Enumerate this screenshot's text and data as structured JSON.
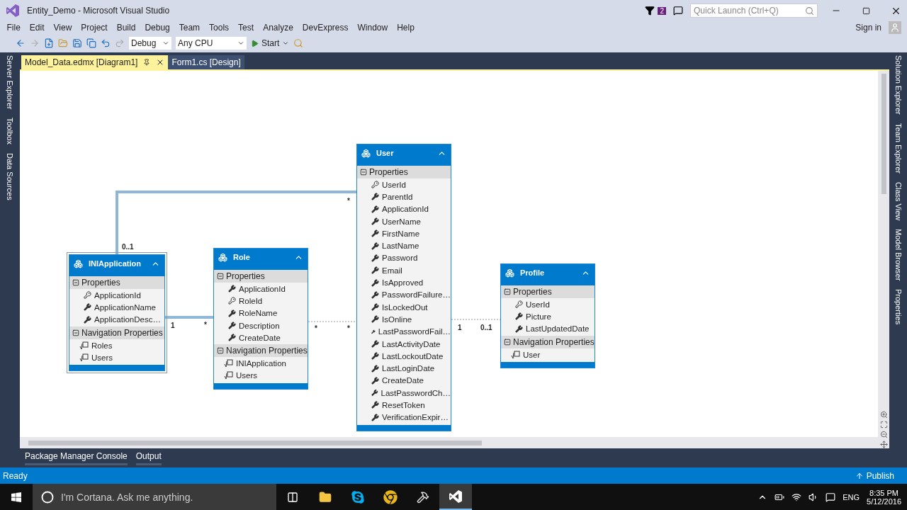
{
  "window": {
    "title": "Entity_Demo - Microsoft Visual Studio"
  },
  "notifications": {
    "count": "2"
  },
  "quick_launch": {
    "placeholder": "Quick Launch (Ctrl+Q)"
  },
  "menu": [
    "File",
    "Edit",
    "View",
    "Project",
    "Build",
    "Debug",
    "Team",
    "Tools",
    "Test",
    "Analyze",
    "DevExpress",
    "Window",
    "Help"
  ],
  "account": {
    "label": "Sign in"
  },
  "toolbar": {
    "configuration": "Debug",
    "platform": "Any CPU",
    "start": "Start"
  },
  "left_tabs": [
    "Server Explorer",
    "Toolbox",
    "Data Sources"
  ],
  "right_tabs": [
    "Solution Explorer",
    "Team Explorer",
    "Class View",
    "Model Browser",
    "Properties"
  ],
  "doc_tabs": [
    {
      "label": "Model_Data.edmx [Diagram1]",
      "selected": true
    },
    {
      "label": "Form1.cs [Design]",
      "selected": false
    }
  ],
  "entities": [
    {
      "name": "INIApplication",
      "selected": true,
      "sections": [
        {
          "label": "Properties",
          "items": [
            {
              "name": "ApplicationId",
              "kind": "key"
            },
            {
              "name": "ApplicationName",
              "kind": "scalar"
            },
            {
              "name": "ApplicationDesc…",
              "kind": "scalar"
            }
          ]
        },
        {
          "label": "Navigation Properties",
          "items": [
            {
              "name": "Roles",
              "kind": "navigation"
            },
            {
              "name": "Users",
              "kind": "navigation"
            }
          ]
        }
      ]
    },
    {
      "name": "Role",
      "selected": false,
      "sections": [
        {
          "label": "Properties",
          "items": [
            {
              "name": "ApplicationId",
              "kind": "scalar"
            },
            {
              "name": "RoleId",
              "kind": "key"
            },
            {
              "name": "RoleName",
              "kind": "scalar"
            },
            {
              "name": "Description",
              "kind": "scalar"
            },
            {
              "name": "CreateDate",
              "kind": "scalar"
            }
          ]
        },
        {
          "label": "Navigation Properties",
          "items": [
            {
              "name": "INIApplication",
              "kind": "navigation"
            },
            {
              "name": "Users",
              "kind": "navigation"
            }
          ]
        }
      ]
    },
    {
      "name": "User",
      "selected": false,
      "sections": [
        {
          "label": "Properties",
          "items": [
            {
              "name": "UserId",
              "kind": "key"
            },
            {
              "name": "ParentId",
              "kind": "scalar"
            },
            {
              "name": "ApplicationId",
              "kind": "scalar"
            },
            {
              "name": "UserName",
              "kind": "scalar"
            },
            {
              "name": "FirstName",
              "kind": "scalar"
            },
            {
              "name": "LastName",
              "kind": "scalar"
            },
            {
              "name": "Password",
              "kind": "scalar"
            },
            {
              "name": "Email",
              "kind": "scalar"
            },
            {
              "name": "IsApproved",
              "kind": "scalar"
            },
            {
              "name": "PasswordFailure…",
              "kind": "scalar"
            },
            {
              "name": "IsLockedOut",
              "kind": "scalar"
            },
            {
              "name": "IsOnline",
              "kind": "scalar"
            },
            {
              "name": "LastPasswordFail…",
              "kind": "scalar"
            },
            {
              "name": "LastActivityDate",
              "kind": "scalar"
            },
            {
              "name": "LastLockoutDate",
              "kind": "scalar"
            },
            {
              "name": "LastLoginDate",
              "kind": "scalar"
            },
            {
              "name": "CreateDate",
              "kind": "scalar"
            },
            {
              "name": "LastPasswordCh…",
              "kind": "scalar"
            },
            {
              "name": "ResetToken",
              "kind": "scalar"
            },
            {
              "name": "VerificationExpir…",
              "kind": "scalar"
            }
          ]
        }
      ]
    },
    {
      "name": "Profile",
      "selected": false,
      "sections": [
        {
          "label": "Properties",
          "items": [
            {
              "name": "UserId",
              "kind": "key"
            },
            {
              "name": "Picture",
              "kind": "scalar"
            },
            {
              "name": "LastUpdatedDate",
              "kind": "scalar"
            }
          ]
        },
        {
          "label": "Navigation Properties",
          "items": [
            {
              "name": "User",
              "kind": "navigation"
            }
          ]
        }
      ]
    }
  ],
  "associations": [
    {
      "end_1": "0..1",
      "end_2": "*"
    },
    {
      "end_1": "1",
      "end_2": "*"
    },
    {
      "end_1": "*",
      "end_2": "*"
    },
    {
      "end_1": "1",
      "end_2": "0..1"
    }
  ],
  "tool_tabs": [
    "Package Manager Console",
    "Output"
  ],
  "status": {
    "text": "Ready",
    "action": "Publish"
  },
  "taskbar": {
    "search_placeholder": "I'm Cortana. Ask me anything.",
    "language": "ENG",
    "time": "8:35 PM",
    "date": "5/12/2016"
  }
}
